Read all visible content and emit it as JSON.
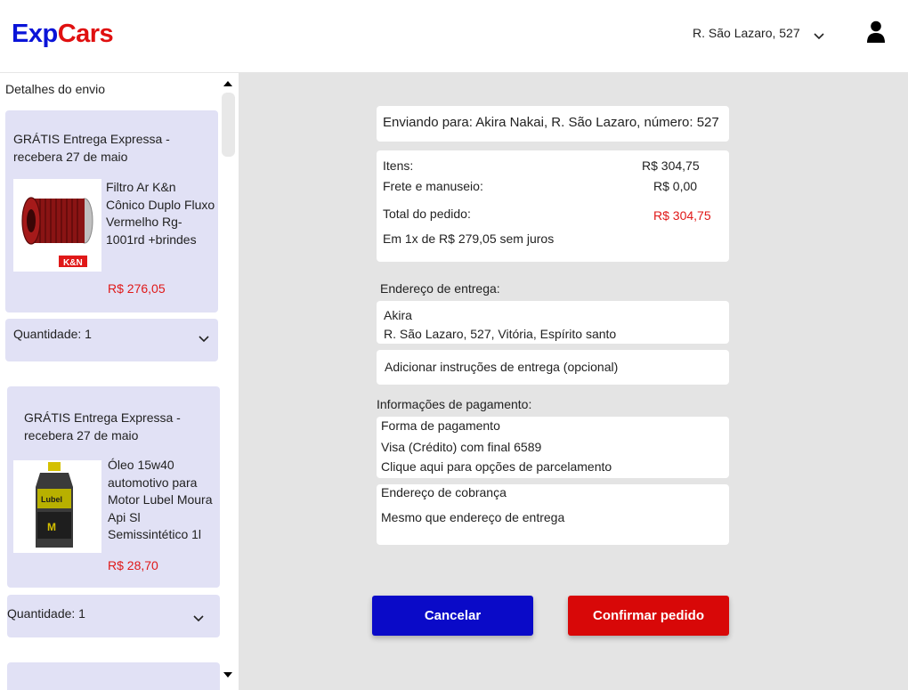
{
  "brand": {
    "part1": "Exp",
    "part2": "Cars",
    "color1": "#0a14d8",
    "color2": "#e01010"
  },
  "header": {
    "address_selector": "R. São Lazaro, 527",
    "icons": [
      "chevron-down-icon",
      "user-icon"
    ]
  },
  "sidebar": {
    "title": "Detalhes do envio",
    "items": [
      {
        "shipping": "GRÁTIS Entrega Expressa - recebera 27 de maio",
        "name": "Filtro Ar K&n Cônico Duplo Fluxo Vermelho Rg-1001rd +brindes",
        "price": "R$ 276,05",
        "quantity": "Quantidade: 1"
      },
      {
        "shipping": "GRÁTIS Entrega Expressa - recebera 27 de maio",
        "name": "Óleo 15w40 automotivo para Motor Lubel Moura Api Sl Semissintético 1l",
        "price": "R$ 28,70",
        "quantity": "Quantidade: 1"
      }
    ]
  },
  "main": {
    "sending_to": "Enviando para: Akira Nakai, R. São Lazaro, número: 527",
    "summary": {
      "items_label": "Itens:",
      "items_value": "R$ 304,75",
      "shipping_label": "Frete e manuseio:",
      "shipping_value": "R$ 0,00",
      "total_label": "Total do pedido:",
      "total_value": "R$ 304,75",
      "installment": "Em 1x de R$ 279,05 sem juros"
    },
    "delivery_heading": "Endereço de entrega:",
    "delivery_name": "Akira",
    "delivery_address": "R. São Lazaro, 527, Vitória, Espírito santo",
    "delivery_instructions": "Adicionar instruções de entrega (opcional)",
    "payment_heading": "Informações de pagamento:",
    "payment_method_title": "Forma de pagamento",
    "payment_card": "Visa (Crédito) com final 6589",
    "payment_installments": "Clique aqui para opções de parcelamento",
    "billing_title": "Endereço de cobrança",
    "billing_value": "Mesmo que endereço de entrega",
    "cancel_label": "Cancelar",
    "confirm_label": "Confirmar pedido",
    "price_color": "#e01818",
    "cancel_color": "#0a0ac8",
    "confirm_color": "#d80808"
  }
}
